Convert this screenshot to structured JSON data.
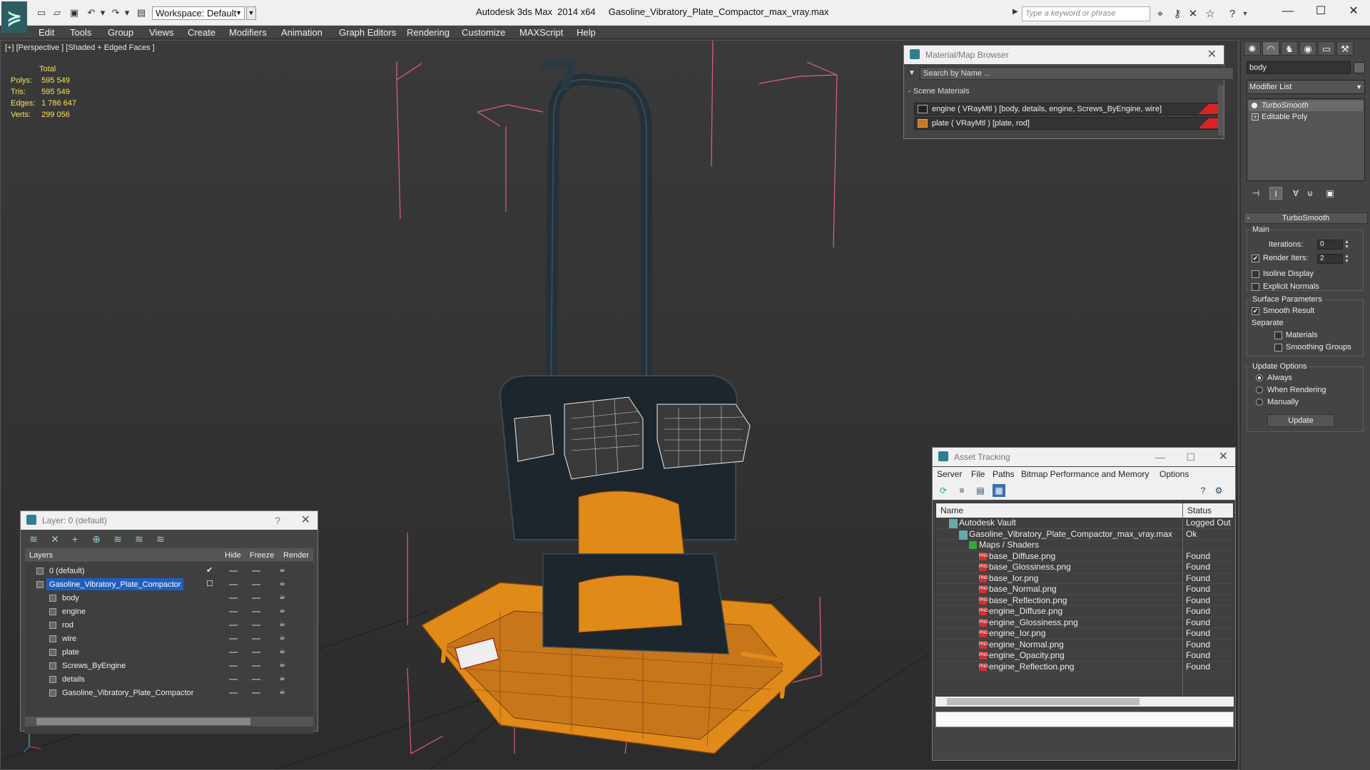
{
  "app": {
    "title": "Autodesk 3ds Max  2014 x64     Gasoline_Vibratory_Plate_Compactor_max_vray.max",
    "workspace": "Workspace: Default",
    "search_placeholder": "Type a keyword or phrase"
  },
  "menu": [
    "Edit",
    "Tools",
    "Group",
    "Views",
    "Create",
    "Modifiers",
    "Animation",
    "Graph Editors",
    "Rendering",
    "Customize",
    "MAXScript",
    "Help"
  ],
  "viewport": {
    "label": "[+] [Perspective ] [Shaded + Edged Faces ]",
    "stats": {
      "total_label": "Total",
      "rows": [
        {
          "label": "Polys:",
          "value": "595 549"
        },
        {
          "label": "Tris:",
          "value": "595 549"
        },
        {
          "label": "Edges:",
          "value": "1 786 647"
        },
        {
          "label": "Verts:",
          "value": "299 056"
        }
      ]
    }
  },
  "material_browser": {
    "title": "Material/Map Browser",
    "search_placeholder": "Search by Name ...",
    "section": "- Scene Materials",
    "materials": [
      {
        "label": "engine  ( VRayMtl )  [body, details, engine, Screws_ByEngine, wire]",
        "swatch": "#222222"
      },
      {
        "label": "plate  ( VRayMtl )  [plate, rod]",
        "swatch": "#c8781a"
      }
    ]
  },
  "layer_explorer": {
    "title": "Layer: 0 (default)",
    "help": "?",
    "columns": {
      "layers": "Layers",
      "hide": "Hide",
      "freeze": "Freeze",
      "render": "Render"
    },
    "rows": [
      {
        "name": "0 (default)",
        "indent": 1,
        "selected": false,
        "check": "✔"
      },
      {
        "name": "Gasoline_Vibratory_Plate_Compactor",
        "indent": 1,
        "selected": true,
        "check": "☐"
      },
      {
        "name": "body",
        "indent": 2,
        "selected": false,
        "check": ""
      },
      {
        "name": "engine",
        "indent": 2,
        "selected": false,
        "check": ""
      },
      {
        "name": "rod",
        "indent": 2,
        "selected": false,
        "check": ""
      },
      {
        "name": "wire",
        "indent": 2,
        "selected": false,
        "check": ""
      },
      {
        "name": "plate",
        "indent": 2,
        "selected": false,
        "check": ""
      },
      {
        "name": "Screws_ByEngine",
        "indent": 2,
        "selected": false,
        "check": ""
      },
      {
        "name": "details",
        "indent": 2,
        "selected": false,
        "check": ""
      },
      {
        "name": "Gasoline_Vibratory_Plate_Compactor",
        "indent": 2,
        "selected": false,
        "check": ""
      }
    ]
  },
  "asset_tracking": {
    "title": "Asset Tracking",
    "menu": [
      "Server",
      "File",
      "Paths",
      "Bitmap Performance and Memory",
      "Options"
    ],
    "columns": {
      "name": "Name",
      "status": "Status"
    },
    "rows": [
      {
        "name": "Autodesk Vault",
        "status": "Logged Out",
        "level": 0,
        "icon": "vault-icon"
      },
      {
        "name": "Gasoline_Vibratory_Plate_Compactor_max_vray.max",
        "status": "Ok",
        "level": 1,
        "icon": "max-file-icon"
      },
      {
        "name": "Maps / Shaders",
        "status": "",
        "level": 2,
        "icon": "maps-folder-icon"
      },
      {
        "name": "base_Diffuse.png",
        "status": "Found",
        "level": 3,
        "icon": "png-icon"
      },
      {
        "name": "base_Glossiness.png",
        "status": "Found",
        "level": 3,
        "icon": "png-icon"
      },
      {
        "name": "base_Ior.png",
        "status": "Found",
        "level": 3,
        "icon": "png-icon"
      },
      {
        "name": "base_Normal.png",
        "status": "Found",
        "level": 3,
        "icon": "png-icon"
      },
      {
        "name": "base_Reflection.png",
        "status": "Found",
        "level": 3,
        "icon": "png-icon"
      },
      {
        "name": "engine_Diffuse.png",
        "status": "Found",
        "level": 3,
        "icon": "png-icon"
      },
      {
        "name": "engine_Glossiness.png",
        "status": "Found",
        "level": 3,
        "icon": "png-icon"
      },
      {
        "name": "engine_Ior.png",
        "status": "Found",
        "level": 3,
        "icon": "png-icon"
      },
      {
        "name": "engine_Normal.png",
        "status": "Found",
        "level": 3,
        "icon": "png-icon"
      },
      {
        "name": "engine_Opacity.png",
        "status": "Found",
        "level": 3,
        "icon": "png-icon"
      },
      {
        "name": "engine_Reflection.png",
        "status": "Found",
        "level": 3,
        "icon": "png-icon"
      }
    ]
  },
  "command_panel": {
    "object_name": "body",
    "modifier_list": "Modifier List",
    "stack": [
      {
        "label": "TurboSmooth",
        "active": true,
        "icon": "bulb-icon"
      },
      {
        "label": "Editable Poly",
        "active": false,
        "icon": "plus-icon"
      }
    ],
    "turbosmooth": {
      "title": "TurboSmooth",
      "main_group": "Main",
      "iterations_label": "Iterations:",
      "iterations_value": "0",
      "render_iters_label": "Render Iters:",
      "render_iters_value": "2",
      "render_iters_checked": true,
      "isoline_label": "Isoline Display",
      "explicit_label": "Explicit Normals",
      "surface_group": "Surface Parameters",
      "smooth_result_label": "Smooth Result",
      "separate_label": "Separate",
      "materials_label": "Materials",
      "smoothing_groups_label": "Smoothing Groups",
      "update_group": "Update Options",
      "always_label": "Always",
      "when_rendering_label": "When Rendering",
      "manually_label": "Manually",
      "update_button": "Update"
    }
  },
  "colors": {
    "selection": "#1f5fc0",
    "stats_text": "#f6e35a",
    "bounding_box": "#e0607a",
    "plate_orange": "#e08a1a"
  }
}
